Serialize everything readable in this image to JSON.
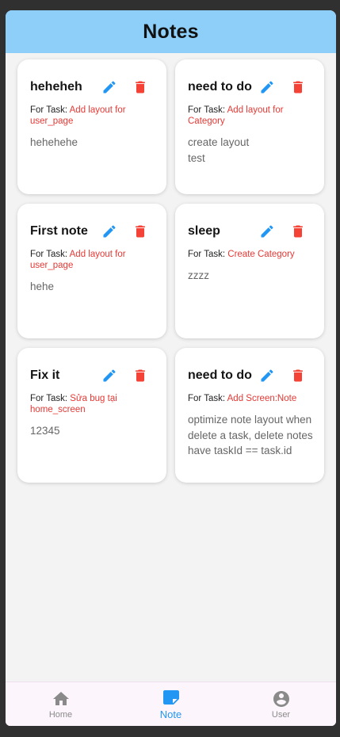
{
  "appbar": {
    "title": "Notes"
  },
  "labels": {
    "task_prefix": "For Task: "
  },
  "notes": [
    {
      "title": "heheheh",
      "task": "Add layout for user_page",
      "content": "hehehehe"
    },
    {
      "title": "need to do",
      "task": "Add layout for Category",
      "content": "create layout\ntest"
    },
    {
      "title": "First note",
      "task": "Add layout for user_page",
      "content": "hehe"
    },
    {
      "title": "sleep",
      "task": "Create Category",
      "content": "zzzz"
    },
    {
      "title": "Fix it",
      "task": "Sửa bug tại home_screen",
      "content": "12345"
    },
    {
      "title": "need to do",
      "task": "Add Screen:Note",
      "content": "optimize note layout when delete a task, delete notes have taskId == task.id"
    }
  ],
  "icons": {
    "edit": "pencil-icon",
    "delete": "trash-icon",
    "home": "home-icon",
    "note": "note-icon",
    "user": "account-circle-icon"
  },
  "colors": {
    "appbar": "#8ecff9",
    "edit": "#2196f3",
    "delete": "#f44336",
    "task_name": "#e53935",
    "nav_active": "#2196f3",
    "nav_inactive": "#8a8a8a"
  },
  "bottom_nav": {
    "home": "Home",
    "note": "Note",
    "user": "User",
    "active": "Note"
  }
}
